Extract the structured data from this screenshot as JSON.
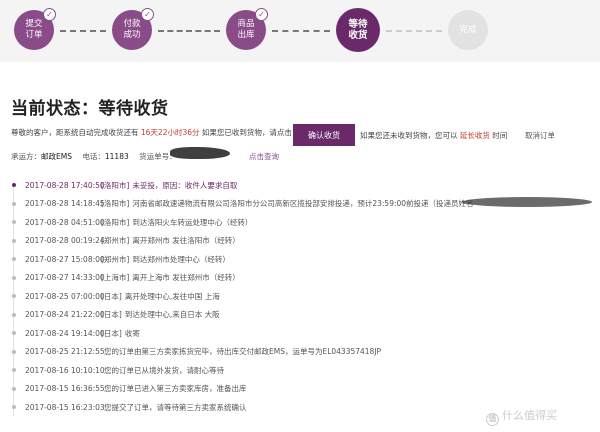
{
  "steps": [
    {
      "label": "提交\n订单",
      "state": "done"
    },
    {
      "label": "付款\n成功",
      "state": "done"
    },
    {
      "label": "商品\n出库",
      "state": "done"
    },
    {
      "label": "等待\n收货",
      "state": "current"
    },
    {
      "label": "完成",
      "state": "todo"
    }
  ],
  "status": {
    "title": "当前状态：等待收货"
  },
  "notice": {
    "prefix": "尊敬的客户，距系统自动完成收货还有",
    "countdown": "16天22小时36分",
    "suffix": "如果您已收到货物，请点击"
  },
  "confirm_button": {
    "label": "确认收货"
  },
  "after_note": {
    "prefix": "如果您还未收到货物，您可以",
    "link": "延长收货",
    "suffix": "时间"
  },
  "cancel_link": {
    "label": "取消订单"
  },
  "carrier": {
    "label": "承运方：",
    "name": "邮政EMS",
    "phone_label": "电话：",
    "phone": "11183",
    "tracking_label": "货运单号：",
    "query_link": "点击查询"
  },
  "tracking": [
    {
      "time": "2017-08-28 17:40:50",
      "location": "[洛阳市]",
      "desc": "未妥投，原因：收件人要求自取"
    },
    {
      "time": "2017-08-28 14:18:45",
      "location": "[洛阳市]",
      "desc": "河南省邮政速递物流有限公司洛阳市分公司高新区揽投部安排投递，预计23:59:00前投递（投递员姓名"
    },
    {
      "time": "2017-08-28 04:51:00",
      "location": "[洛阳市]",
      "desc": "到达洛阳火车转运处理中心（经转）"
    },
    {
      "time": "2017-08-28 00:19:24",
      "location": "[郑州市]",
      "desc": "离开郑州市 发往洛阳市（经转）"
    },
    {
      "time": "2017-08-27 15:08:00",
      "location": "[郑州市]",
      "desc": "到达郑州市处理中心（经转）"
    },
    {
      "time": "2017-08-27 14:33:00",
      "location": "[上海市]",
      "desc": "离开上海市 发往郑州市（经转）"
    },
    {
      "time": "2017-08-25 07:00:00",
      "location": "[日本]",
      "desc": "离开处理中心,发往中国 上海"
    },
    {
      "time": "2017-08-24 21:22:00",
      "location": "[日本]",
      "desc": "到达处理中心,来自日本 大阪"
    },
    {
      "time": "2017-08-24 19:14:00",
      "location": "[日本]",
      "desc": "收寄"
    },
    {
      "time": "2017-08-25 21:12:55",
      "location": "",
      "desc": "您的订单由第三方卖家拣货完毕，待出库交付邮政EMS，运单号为EL043357418JP"
    },
    {
      "time": "2017-08-16 10:10:10",
      "location": "",
      "desc": "您的订单已从境外发货，请耐心等待"
    },
    {
      "time": "2017-08-15 16:36:55",
      "location": "",
      "desc": "您的订单已进入第三方卖家库房，准备出库"
    },
    {
      "time": "2017-08-15 16:23:03",
      "location": "",
      "desc": "您提交了订单，请等待第三方卖家系统确认"
    }
  ],
  "watermark": {
    "icon": "值",
    "text": "什么值得买"
  },
  "colors": {
    "accent": "#6a2a6a",
    "done": "#8a4b89",
    "todo": "#e2e2e2",
    "highlight": "#c0392b"
  }
}
